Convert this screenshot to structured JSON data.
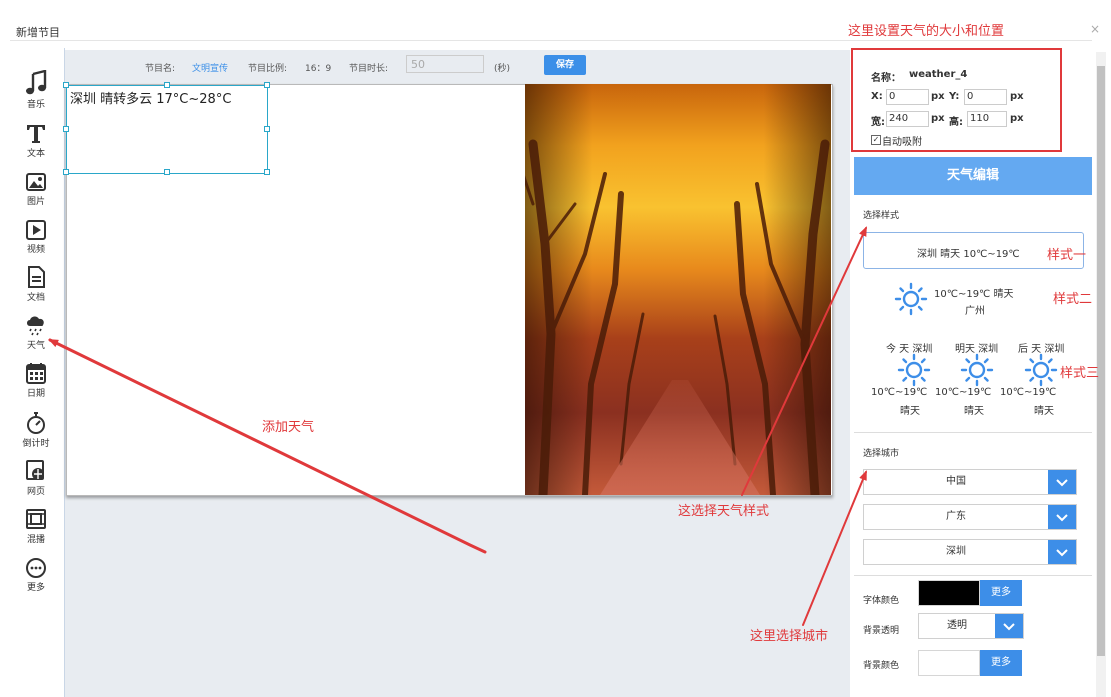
{
  "dialog": {
    "title": "新增节目",
    "close": "×"
  },
  "toolbar": [
    {
      "icon": "music-note-icon",
      "label": "音乐"
    },
    {
      "icon": "text-icon",
      "label": "文本"
    },
    {
      "icon": "image-icon",
      "label": "图片"
    },
    {
      "icon": "video-icon",
      "label": "视频"
    },
    {
      "icon": "document-icon",
      "label": "文档"
    },
    {
      "icon": "weather-icon",
      "label": "天气"
    },
    {
      "icon": "calendar-icon",
      "label": "日期"
    },
    {
      "icon": "stopwatch-icon",
      "label": "倒计时"
    },
    {
      "icon": "web-icon",
      "label": "网页"
    },
    {
      "icon": "carousel-icon",
      "label": "混播"
    },
    {
      "icon": "more-icon",
      "label": "更多"
    }
  ],
  "program_header": {
    "name_label": "节目名:",
    "name_value": "文明宣传",
    "ratio_label": "节目比例:",
    "ratio_value": "16：9",
    "duration_label": "节目时长:",
    "duration_value": "50",
    "duration_unit": "(秒)",
    "save_label": "保存"
  },
  "canvas_widget": {
    "text": "深圳   晴转多云    17°C~28°C"
  },
  "properties": {
    "name_label": "名称：",
    "name_value": "weather_4",
    "x_label": "X:",
    "x_value": "0",
    "y_label": "Y:",
    "y_value": "0",
    "w_label": "宽:",
    "w_value": "240",
    "h_label": "高:",
    "h_value": "110",
    "unit": "px",
    "snap_label": "自动吸附",
    "snap_checked": true
  },
  "weather_panel": {
    "title": "天气编辑",
    "style_section": "选择样式",
    "style1_text": "深圳 晴天 10℃~19℃",
    "style2_temp": "10℃~19℃ 晴天",
    "style2_city": "广州",
    "style3": [
      {
        "head": "今 天 深圳",
        "temp": "10℃~19℃",
        "cond": "晴天"
      },
      {
        "head": "明天 深圳",
        "temp": "10℃~19℃",
        "cond": "晴天"
      },
      {
        "head": "后 天 深圳",
        "temp": "10℃~19℃",
        "cond": "晴天"
      }
    ],
    "city_section": "选择城市",
    "country": "中国",
    "province": "广东",
    "city": "深圳",
    "font_color_label": "字体颜色",
    "font_color": "#000000",
    "more_label": "更多",
    "bg_opacity_label": "背景透明",
    "bg_opacity_value": "透明",
    "bg_color_label": "背景颜色",
    "bg_color": "#ffffff"
  },
  "annotations": {
    "top": "这里设置天气的大小和位置",
    "style1": "样式一",
    "style2": "样式二",
    "style3": "样式三",
    "add_weather": "添加天气",
    "choose_style": "这选择天气样式",
    "choose_city": "这里选择城市"
  },
  "colors": {
    "accent": "#3d8ee8",
    "annotation": "#e0393b",
    "header": "#64a9f1"
  }
}
